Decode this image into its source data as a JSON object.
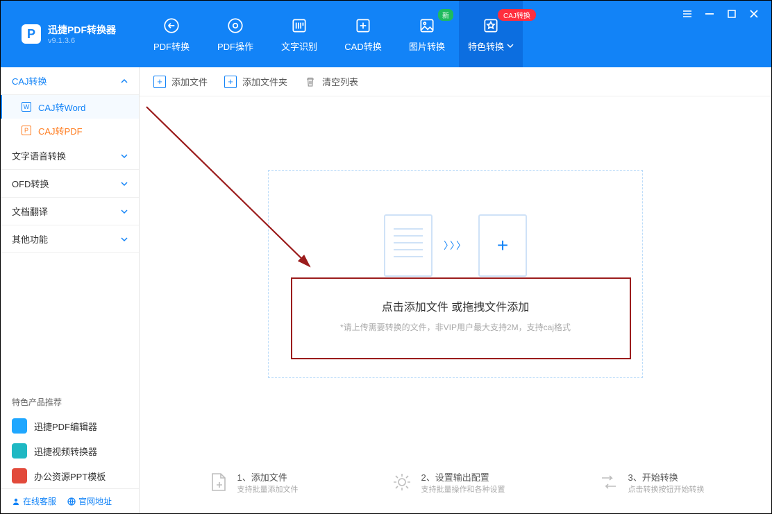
{
  "app": {
    "title": "迅捷PDF转换器",
    "version": "v9.1.3.6"
  },
  "nav": {
    "items": [
      {
        "label": "PDF转换"
      },
      {
        "label": "PDF操作"
      },
      {
        "label": "文字识别"
      },
      {
        "label": "CAD转换"
      },
      {
        "label": "图片转换",
        "badge": "新"
      },
      {
        "label": "特色转换",
        "active": true,
        "badgeRed": "CAJ转换"
      }
    ]
  },
  "sidebar": {
    "groups": [
      {
        "label": "CAJ转换",
        "open": true,
        "items": [
          {
            "label": "CAJ转Word",
            "active": true
          },
          {
            "label": "CAJ转PDF",
            "selected": true
          }
        ]
      },
      {
        "label": "文字语音转换"
      },
      {
        "label": "OFD转换"
      },
      {
        "label": "文档翻译"
      },
      {
        "label": "其他功能"
      }
    ],
    "promoTitle": "特色产品推荐",
    "promos": [
      {
        "label": "迅捷PDF编辑器"
      },
      {
        "label": "迅捷视频转换器"
      },
      {
        "label": "办公资源PPT模板"
      }
    ],
    "footer": {
      "support": "在线客服",
      "site": "官网地址"
    }
  },
  "toolbar": {
    "addFile": "添加文件",
    "addFolder": "添加文件夹",
    "clearList": "清空列表"
  },
  "drop": {
    "title": "点击添加文件 或拖拽文件添加",
    "hint": "*请上传需要转换的文件，非VIP用户最大支持2M，支持caj格式"
  },
  "steps": {
    "s1": {
      "title": "1、添加文件",
      "sub": "支持批量添加文件"
    },
    "s2": {
      "title": "2、设置输出配置",
      "sub": "支持批量操作和各种设置"
    },
    "s3": {
      "title": "3、开始转换",
      "sub": "点击转换按钮开始转换"
    }
  }
}
